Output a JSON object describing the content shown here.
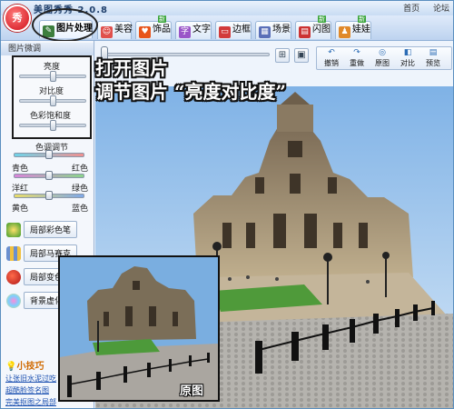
{
  "app": {
    "title": "美图秀秀 2.0.8",
    "logo_text": "秀",
    "links": [
      "首页",
      "论坛"
    ]
  },
  "tabs": [
    {
      "label": "图片处理",
      "icon": "image-edit-icon",
      "active": true,
      "new": false
    },
    {
      "label": "美容",
      "icon": "face-icon",
      "active": false,
      "new": false
    },
    {
      "label": "饰品",
      "icon": "heart-icon",
      "active": false,
      "new": true
    },
    {
      "label": "文字",
      "icon": "text-icon",
      "active": false,
      "new": false
    },
    {
      "label": "边框",
      "icon": "frame-icon",
      "active": false,
      "new": false
    },
    {
      "label": "场景",
      "icon": "scene-icon",
      "active": false,
      "new": false
    },
    {
      "label": "闪图",
      "icon": "flash-icon",
      "active": false,
      "new": true
    },
    {
      "label": "娃娃",
      "icon": "doll-icon",
      "active": false,
      "new": true
    }
  ],
  "new_badge": "新",
  "left_panel": {
    "header": "图片微调",
    "brightness_label": "亮度",
    "contrast_label": "对比度",
    "saturation_label": "色彩饱和度",
    "color_tone_label": "色调调节",
    "tone_sliders": [
      {
        "left": "青色",
        "right": "红色"
      },
      {
        "left": "洋红",
        "right": "绿色"
      },
      {
        "left": "黄色",
        "right": "蓝色"
      }
    ],
    "buttons": [
      "局部彩色笔",
      "局部马赛克",
      "局部变色笔",
      "背景虚化"
    ],
    "tip_title": "小技巧",
    "tip_links": [
      "让张旧水泥过吃",
      "超酷脸签名图",
      "完美抠图之局部"
    ]
  },
  "toolbar": {
    "buttons": [
      "撤销",
      "重做",
      "原图",
      "对比",
      "预览"
    ],
    "zoom_fit_icon": "fit-screen-icon",
    "zoom_actual_icon": "actual-size-icon"
  },
  "annotations": {
    "line1": "打开图片",
    "line2": "调节图片 “亮度对比度”"
  },
  "inset_label": "原图",
  "colors": {
    "accent_blue": "#5b8fbf",
    "logo_red": "#d0101a",
    "tip_orange": "#d06a00"
  }
}
